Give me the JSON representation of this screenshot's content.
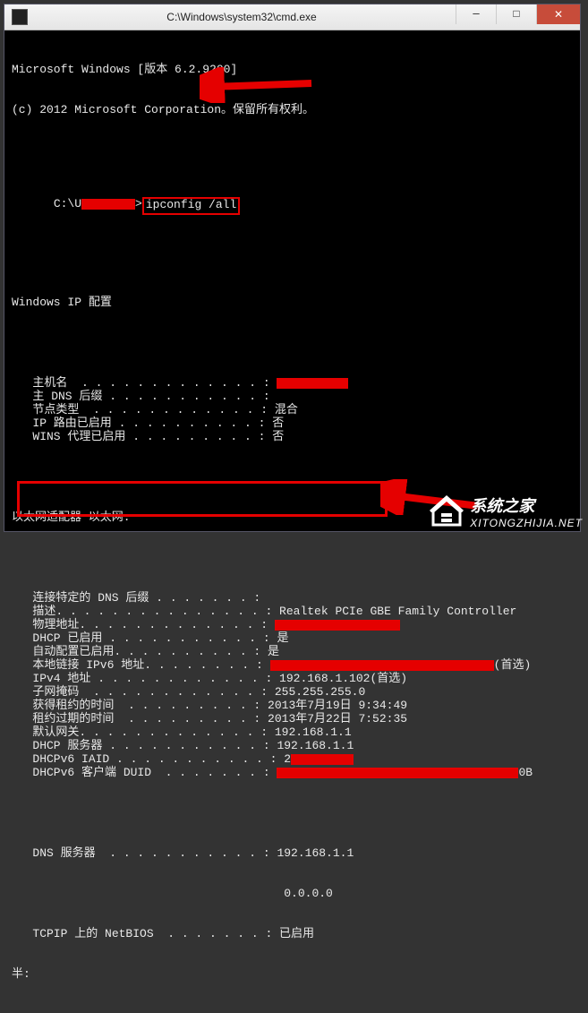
{
  "window": {
    "title": "C:\\Windows\\system32\\cmd.exe",
    "minimize_glyph": "─",
    "maximize_glyph": "□",
    "close_glyph": "✕"
  },
  "console": {
    "header1": "Microsoft Windows [版本 6.2.9200]",
    "header2": "(c) 2012 Microsoft Corporation。保留所有权利。",
    "prompt_prefix": "C:\\U",
    "prompt_suffix": ">",
    "command": "ipconfig /all",
    "heading_ipconfig": "Windows IP 配置",
    "rows_ipcfg": [
      {
        "label": "   主机名  . . . . . . . . . . . . . : ",
        "value": "",
        "redact": 80
      },
      {
        "label": "   主 DNS 后缀 . . . . . . . . . . . :",
        "value": ""
      },
      {
        "label": "   节点类型  . . . . . . . . . . . . : ",
        "value": "混合"
      },
      {
        "label": "   IP 路由已启用 . . . . . . . . . . : ",
        "value": "否"
      },
      {
        "label": "   WINS 代理已启用 . . . . . . . . . : ",
        "value": "否"
      }
    ],
    "heading_eth": "以太网适配器 以太网:",
    "rows_eth": [
      {
        "label": "   连接特定的 DNS 后缀 . . . . . . . :",
        "value": ""
      },
      {
        "label": "   描述. . . . . . . . . . . . . . . : ",
        "value": "Realtek PCIe GBE Family Controller"
      },
      {
        "label": "   物理地址. . . . . . . . . . . . . : ",
        "value": "",
        "redact": 140
      },
      {
        "label": "   DHCP 已启用 . . . . . . . . . . . : ",
        "value": "是"
      },
      {
        "label": "   自动配置已启用. . . . . . . . . . : ",
        "value": "是"
      },
      {
        "label": "   本地链接 IPv6 地址. . . . . . . . : ",
        "value": "",
        "redact": 250,
        "suffix": "(首选)"
      },
      {
        "label": "   IPv4 地址 . . . . . . . . . . . . : ",
        "value": "192.168.1.102(首选)"
      },
      {
        "label": "   子网掩码  . . . . . . . . . . . . : ",
        "value": "255.255.255.0"
      },
      {
        "label": "   获得租约的时间  . . . . . . . . . : ",
        "value": "2013年7月19日 9:34:49"
      },
      {
        "label": "   租约过期的时间  . . . . . . . . . : ",
        "value": "2013年7月22日 7:52:35"
      },
      {
        "label": "   默认网关. . . . . . . . . . . . . : ",
        "value": "192.168.1.1"
      },
      {
        "label": "   DHCP 服务器 . . . . . . . . . . . : ",
        "value": "192.168.1.1"
      },
      {
        "label": "   DHCPv6 IAID . . . . . . . . . . . : ",
        "value": "2",
        "redact": 70
      },
      {
        "label": "   DHCPv6 客户端 DUID  . . . . . . . : ",
        "value": "",
        "redact": 270,
        "suffix": "0B"
      }
    ],
    "dns_label": "   DNS 服务器  . . . . . . . . . . . : ",
    "dns_value1": "192.168.1.1",
    "dns_value2_pad": "                                       ",
    "dns_value2": "0.0.0.0",
    "netbios_label": "   TCPIP 上的 NetBIOS  . . . . . . . : ",
    "netbios_value": "已启用",
    "cut_off": "半:"
  },
  "watermark": {
    "name": "系统之家",
    "url": "XITONGZHIJIA.NET"
  }
}
